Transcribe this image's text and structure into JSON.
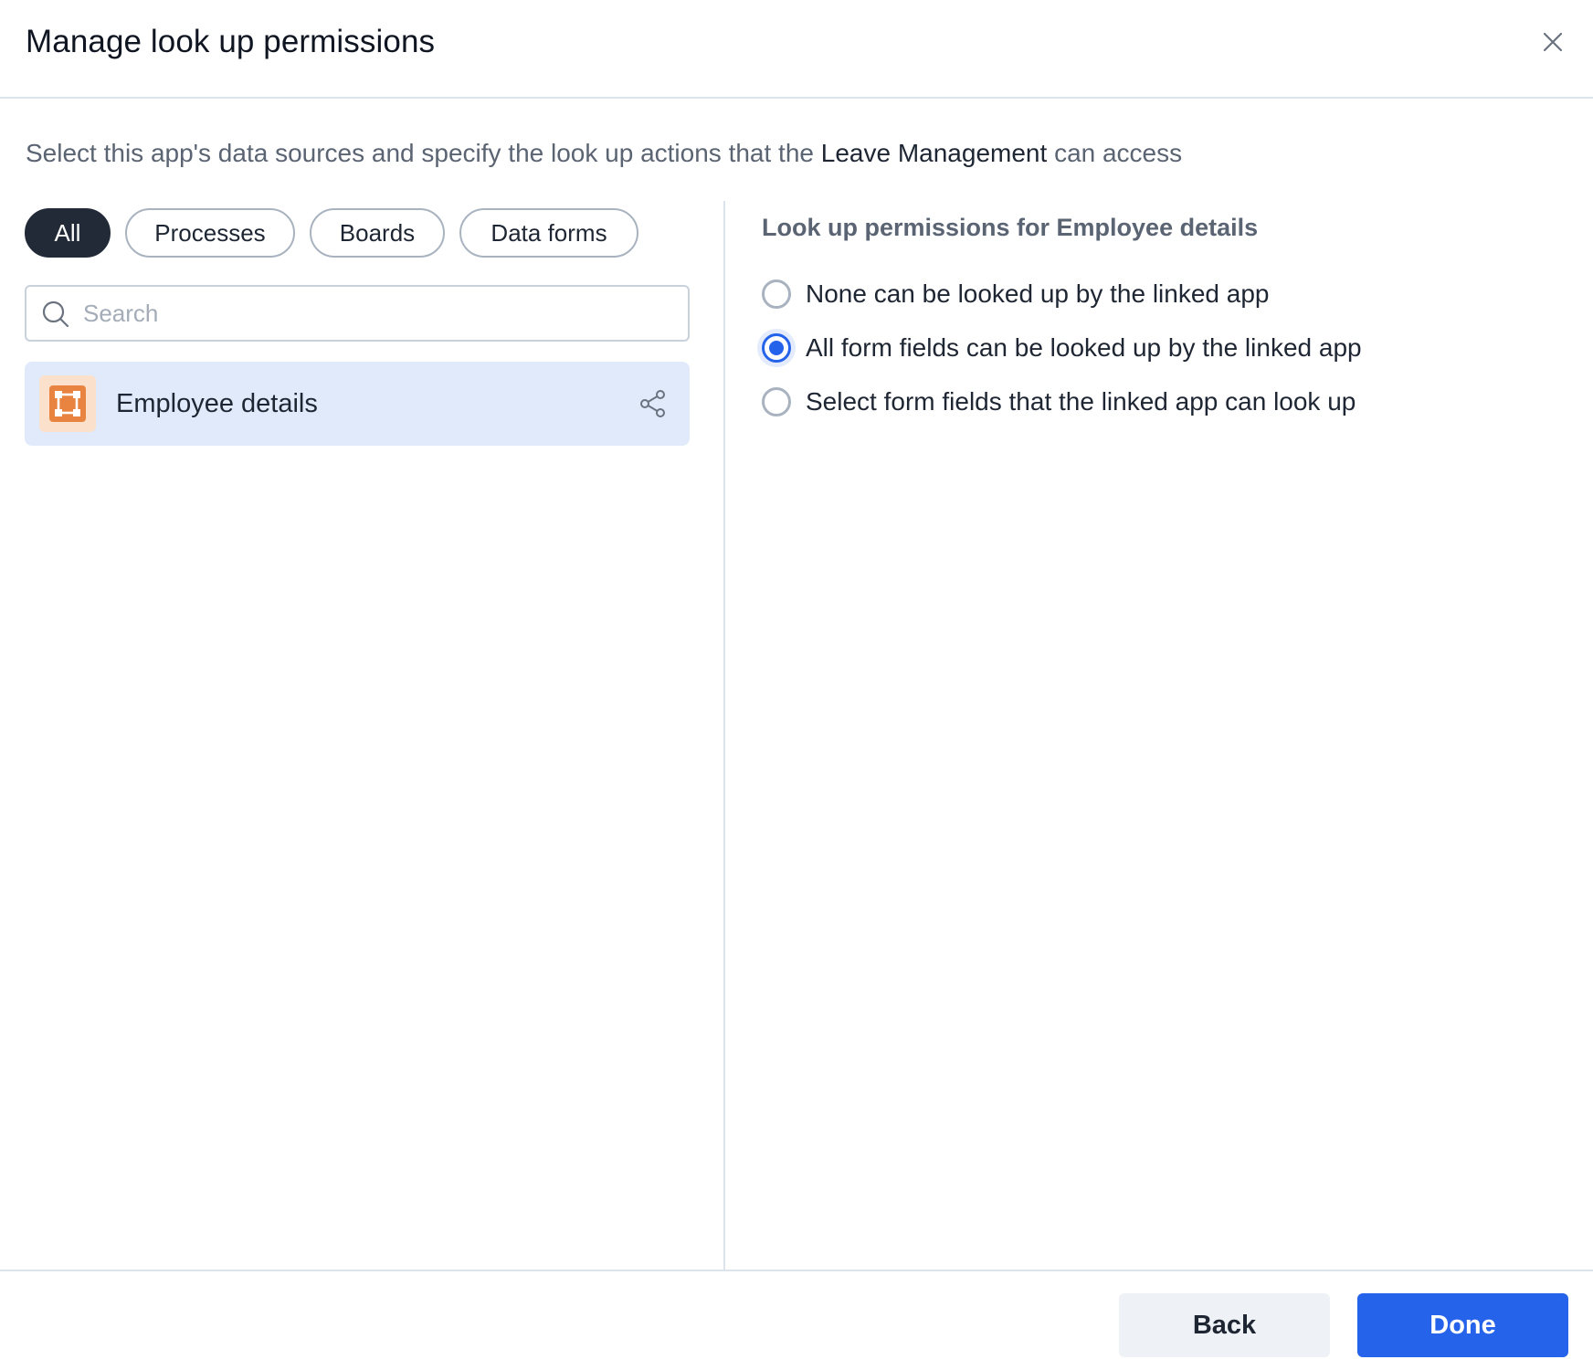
{
  "dialog": {
    "title": "Manage look up permissions",
    "close_icon": "close-icon"
  },
  "subtitle": {
    "prefix": "Select this app's data sources and specify the look up actions that the",
    "app_name": "Leave Management",
    "suffix": "can access"
  },
  "filters": [
    {
      "label": "All",
      "active": true
    },
    {
      "label": "Processes",
      "active": false
    },
    {
      "label": "Boards",
      "active": false
    },
    {
      "label": "Data forms",
      "active": false
    }
  ],
  "search": {
    "placeholder": "Search",
    "value": "",
    "icon": "search-icon"
  },
  "sources": [
    {
      "label": "Employee details",
      "icon": "data-form-icon",
      "action_icon": "share-icon",
      "selected": true
    }
  ],
  "permissions": {
    "heading": "Look up permissions for Employee details",
    "options": [
      {
        "label": "None can be looked up by the linked app",
        "checked": false
      },
      {
        "label": "All form fields can be looked up by the linked app",
        "checked": true
      },
      {
        "label": "Select form fields that the linked app can look up",
        "checked": false
      }
    ]
  },
  "footer": {
    "back_label": "Back",
    "done_label": "Done"
  },
  "colors": {
    "accent": "#2563eb",
    "active_chip": "#222a38",
    "selected_row": "#e0eafb",
    "item_icon_bg": "#fbe0cc",
    "item_icon_fg": "#e8843f"
  }
}
